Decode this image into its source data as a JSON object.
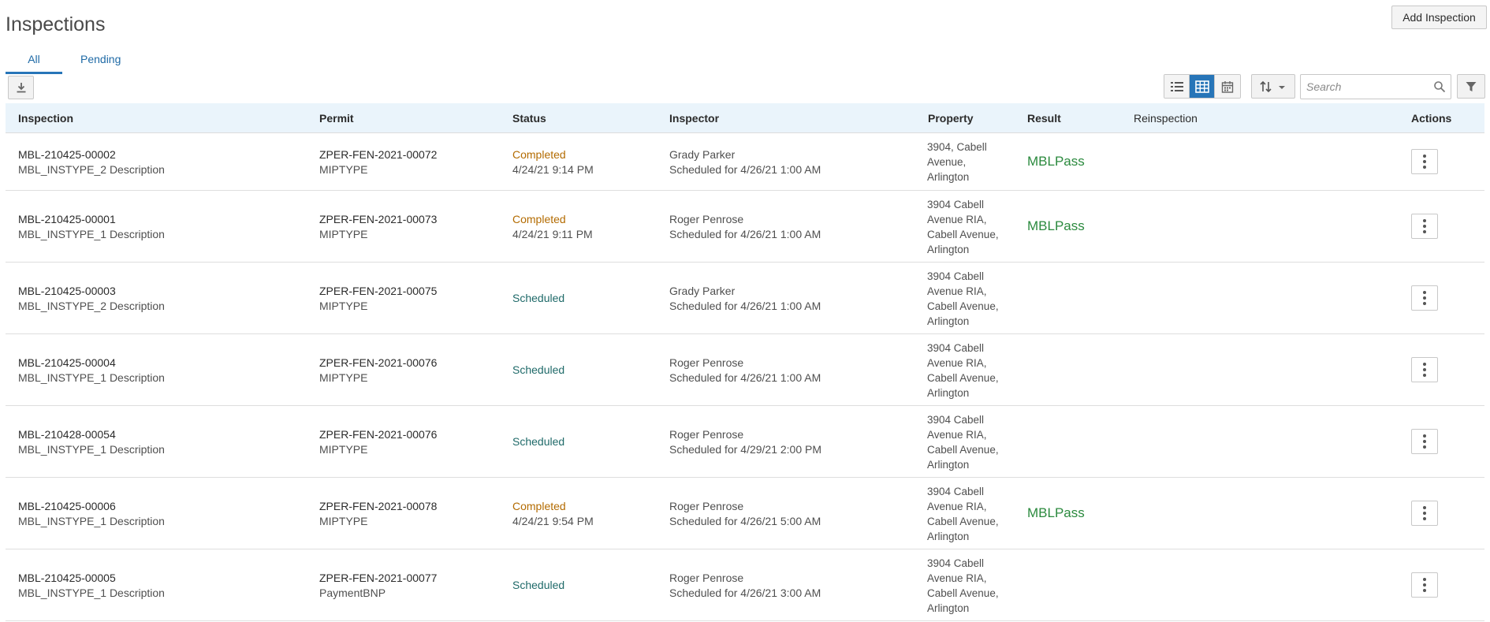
{
  "page": {
    "title": "Inspections",
    "add_button": "Add Inspection"
  },
  "tabs": [
    {
      "label": "All",
      "active": true
    },
    {
      "label": "Pending",
      "active": false
    }
  ],
  "toolbar": {
    "download_icon": "download-icon",
    "views": [
      "list-view-icon",
      "table-view-icon",
      "calendar-view-icon"
    ],
    "active_view": "table-view-icon",
    "sort_icon": "sort-icon",
    "search_placeholder": "Search",
    "filter_icon": "filter-icon"
  },
  "columns": [
    "Inspection",
    "Permit",
    "Status",
    "Inspector",
    "Property",
    "Result",
    "Reinspection",
    "Actions"
  ],
  "rows": [
    {
      "id": "MBL-210425-00002",
      "desc": "MBL_INSTYPE_2 Description",
      "permit": "ZPER-FEN-2021-00072",
      "permit_type": "MIPTYPE",
      "status": "Completed",
      "status_date": "4/24/21 9:14 PM",
      "inspector": "Grady Parker",
      "scheduled": "Scheduled for 4/26/21 1:00 AM",
      "property": [
        "3904, Cabell",
        "Avenue,",
        "Arlington"
      ],
      "result": "MBLPass"
    },
    {
      "id": "MBL-210425-00001",
      "desc": "MBL_INSTYPE_1 Description",
      "permit": "ZPER-FEN-2021-00073",
      "permit_type": "MIPTYPE",
      "status": "Completed",
      "status_date": "4/24/21 9:11 PM",
      "inspector": "Roger Penrose",
      "scheduled": "Scheduled for 4/26/21 1:00 AM",
      "property": [
        "3904 Cabell",
        "Avenue RIA,",
        "Cabell Avenue,",
        "Arlington"
      ],
      "result": "MBLPass"
    },
    {
      "id": "MBL-210425-00003",
      "desc": "MBL_INSTYPE_2 Description",
      "permit": "ZPER-FEN-2021-00075",
      "permit_type": "MIPTYPE",
      "status": "Scheduled",
      "status_date": "",
      "inspector": "Grady Parker",
      "scheduled": "Scheduled for 4/26/21 1:00 AM",
      "property": [
        "3904 Cabell",
        "Avenue RIA,",
        "Cabell Avenue,",
        "Arlington"
      ],
      "result": ""
    },
    {
      "id": "MBL-210425-00004",
      "desc": "MBL_INSTYPE_1 Description",
      "permit": "ZPER-FEN-2021-00076",
      "permit_type": "MIPTYPE",
      "status": "Scheduled",
      "status_date": "",
      "inspector": "Roger Penrose",
      "scheduled": "Scheduled for 4/26/21 1:00 AM",
      "property": [
        "3904 Cabell",
        "Avenue RIA,",
        "Cabell Avenue,",
        "Arlington"
      ],
      "result": ""
    },
    {
      "id": "MBL-210428-00054",
      "desc": "MBL_INSTYPE_1 Description",
      "permit": "ZPER-FEN-2021-00076",
      "permit_type": "MIPTYPE",
      "status": "Scheduled",
      "status_date": "",
      "inspector": "Roger Penrose",
      "scheduled": "Scheduled for 4/29/21 2:00 PM",
      "property": [
        "3904 Cabell",
        "Avenue RIA,",
        "Cabell Avenue,",
        "Arlington"
      ],
      "result": ""
    },
    {
      "id": "MBL-210425-00006",
      "desc": "MBL_INSTYPE_1 Description",
      "permit": "ZPER-FEN-2021-00078",
      "permit_type": "MIPTYPE",
      "status": "Completed",
      "status_date": "4/24/21 9:54 PM",
      "inspector": "Roger Penrose",
      "scheduled": "Scheduled for 4/26/21 5:00 AM",
      "property": [
        "3904 Cabell",
        "Avenue RIA,",
        "Cabell Avenue,",
        "Arlington"
      ],
      "result": "MBLPass"
    },
    {
      "id": "MBL-210425-00005",
      "desc": "MBL_INSTYPE_1 Description",
      "permit": "ZPER-FEN-2021-00077",
      "permit_type": "PaymentBNP",
      "status": "Scheduled",
      "status_date": "",
      "inspector": "Roger Penrose",
      "scheduled": "Scheduled for 4/26/21 3:00 AM",
      "property": [
        "3904 Cabell",
        "Avenue RIA,",
        "Cabell Avenue,",
        "Arlington"
      ],
      "result": ""
    }
  ],
  "colors": {
    "accent": "#2775b8",
    "header_bg": "#eaf4fb",
    "status_completed": "#b36b00",
    "status_scheduled": "#1f6a69",
    "result_pass": "#2b8a3e"
  }
}
